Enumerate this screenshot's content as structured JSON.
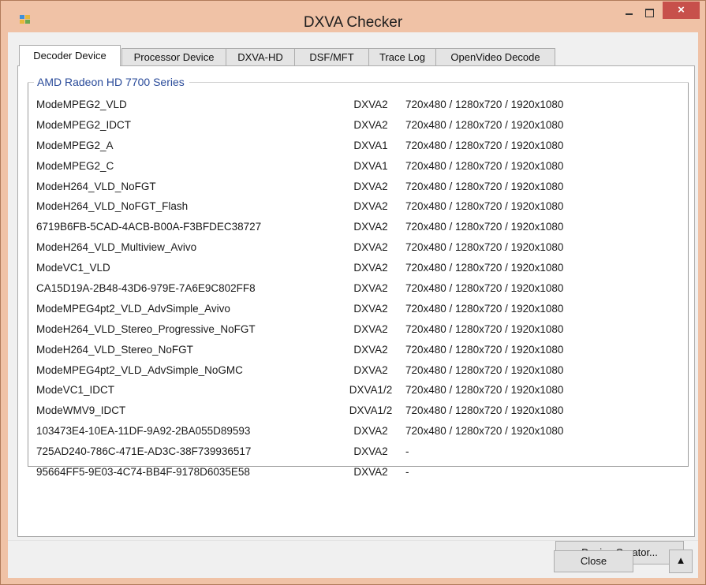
{
  "window": {
    "title": "DXVA Checker",
    "controls": {
      "minimize": "minimize",
      "maximize": "maximize",
      "close": "×"
    }
  },
  "tabs": [
    {
      "label": "Decoder Device",
      "active": true
    },
    {
      "label": "Processor Device",
      "active": false
    },
    {
      "label": "DXVA-HD",
      "active": false
    },
    {
      "label": "DSF/MFT",
      "active": false
    },
    {
      "label": "Trace Log",
      "active": false
    },
    {
      "label": "OpenVideo Decode",
      "active": false
    }
  ],
  "group": {
    "title": "AMD Radeon HD 7700 Series"
  },
  "decoders": [
    {
      "name": "ModeMPEG2_VLD",
      "api": "DXVA2",
      "resolutions": "720x480 / 1280x720 / 1920x1080"
    },
    {
      "name": "ModeMPEG2_IDCT",
      "api": "DXVA2",
      "resolutions": "720x480 / 1280x720 / 1920x1080"
    },
    {
      "name": "ModeMPEG2_A",
      "api": "DXVA1",
      "resolutions": "720x480 / 1280x720 / 1920x1080"
    },
    {
      "name": "ModeMPEG2_C",
      "api": "DXVA1",
      "resolutions": "720x480 / 1280x720 / 1920x1080"
    },
    {
      "name": "ModeH264_VLD_NoFGT",
      "api": "DXVA2",
      "resolutions": "720x480 / 1280x720 / 1920x1080"
    },
    {
      "name": "ModeH264_VLD_NoFGT_Flash",
      "api": "DXVA2",
      "resolutions": "720x480 / 1280x720 / 1920x1080"
    },
    {
      "name": "6719B6FB-5CAD-4ACB-B00A-F3BFDEC38727",
      "api": "DXVA2",
      "resolutions": "720x480 / 1280x720 / 1920x1080"
    },
    {
      "name": "ModeH264_VLD_Multiview_Avivo",
      "api": "DXVA2",
      "resolutions": "720x480 / 1280x720 / 1920x1080"
    },
    {
      "name": "ModeVC1_VLD",
      "api": "DXVA2",
      "resolutions": "720x480 / 1280x720 / 1920x1080"
    },
    {
      "name": "CA15D19A-2B48-43D6-979E-7A6E9C802FF8",
      "api": "DXVA2",
      "resolutions": "720x480 / 1280x720 / 1920x1080"
    },
    {
      "name": "ModeMPEG4pt2_VLD_AdvSimple_Avivo",
      "api": "DXVA2",
      "resolutions": "720x480 / 1280x720 / 1920x1080"
    },
    {
      "name": "ModeH264_VLD_Stereo_Progressive_NoFGT",
      "api": "DXVA2",
      "resolutions": "720x480 / 1280x720 / 1920x1080"
    },
    {
      "name": "ModeH264_VLD_Stereo_NoFGT",
      "api": "DXVA2",
      "resolutions": "720x480 / 1280x720 / 1920x1080"
    },
    {
      "name": "ModeMPEG4pt2_VLD_AdvSimple_NoGMC",
      "api": "DXVA2",
      "resolutions": "720x480 / 1280x720 / 1920x1080"
    },
    {
      "name": "ModeVC1_IDCT",
      "api": "DXVA1/2",
      "resolutions": "720x480 / 1280x720 / 1920x1080"
    },
    {
      "name": "ModeWMV9_IDCT",
      "api": "DXVA1/2",
      "resolutions": "720x480 / 1280x720 / 1920x1080"
    },
    {
      "name": "103473E4-10EA-11DF-9A92-2BA055D89593",
      "api": "DXVA2",
      "resolutions": "720x480 / 1280x720 / 1920x1080"
    },
    {
      "name": "725AD240-786C-471E-AD3C-38F739936517",
      "api": "DXVA2",
      "resolutions": "-"
    },
    {
      "name": "95664FF5-9E03-4C74-BB4F-9178D6035E58",
      "api": "DXVA2",
      "resolutions": "-"
    }
  ],
  "buttons": {
    "device_creator": "Device Creator...",
    "close": "Close",
    "expand": "▲"
  }
}
